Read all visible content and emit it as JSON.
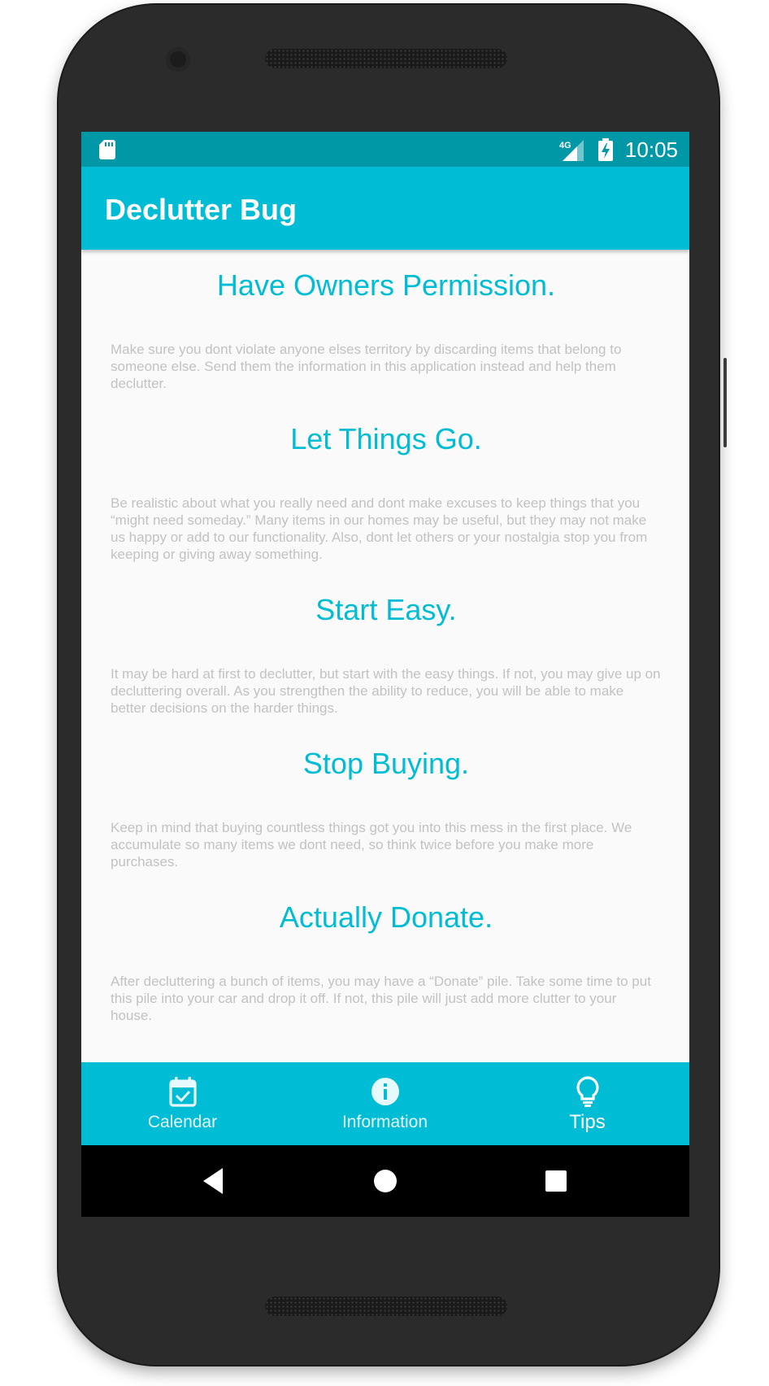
{
  "status_bar": {
    "network": "4G",
    "time": "10:05"
  },
  "app_bar": {
    "title": "Declutter Bug"
  },
  "tips": [
    {
      "title": "Have Owners Permission.",
      "body": "Make sure you dont violate anyone elses territory by discarding items that belong to someone else. Send them the information in this application instead and help them declutter."
    },
    {
      "title": "Let Things Go.",
      "body": "Be realistic about what you really need and dont make excuses to keep things that you “might need someday.” Many items in our homes may be useful, but they may not make us happy or add to our functionality. Also, dont let others or your nostalgia stop you from keeping or giving away something."
    },
    {
      "title": "Start Easy.",
      "body": "It may be hard at first to declutter, but start with the easy things. If not, you may give up on decluttering overall. As you strengthen the ability to reduce, you will be able to make better decisions on the harder things."
    },
    {
      "title": "Stop Buying.",
      "body": "Keep in mind that buying countless things got you into this mess in the first place. We accumulate so many items we dont need, so think twice before you make more purchases."
    },
    {
      "title": "Actually Donate.",
      "body": "After decluttering a bunch of items, you may have a “Donate” pile. Take some time to put this pile into your car and drop it off. If not, this pile will just add more clutter to your house."
    }
  ],
  "bottom_nav": {
    "items": [
      {
        "label": "Calendar",
        "icon": "calendar-check-icon",
        "active": false
      },
      {
        "label": "Information",
        "icon": "info-icon",
        "active": false
      },
      {
        "label": "Tips",
        "icon": "lightbulb-icon",
        "active": true
      }
    ]
  },
  "system_nav": {
    "icons": [
      "back-icon",
      "home-icon",
      "recents-icon"
    ]
  },
  "colors": {
    "primary": "#00bcd4",
    "primary_dark": "#0097a7",
    "body_text": "#c2c2c2",
    "background": "#fafafa"
  }
}
